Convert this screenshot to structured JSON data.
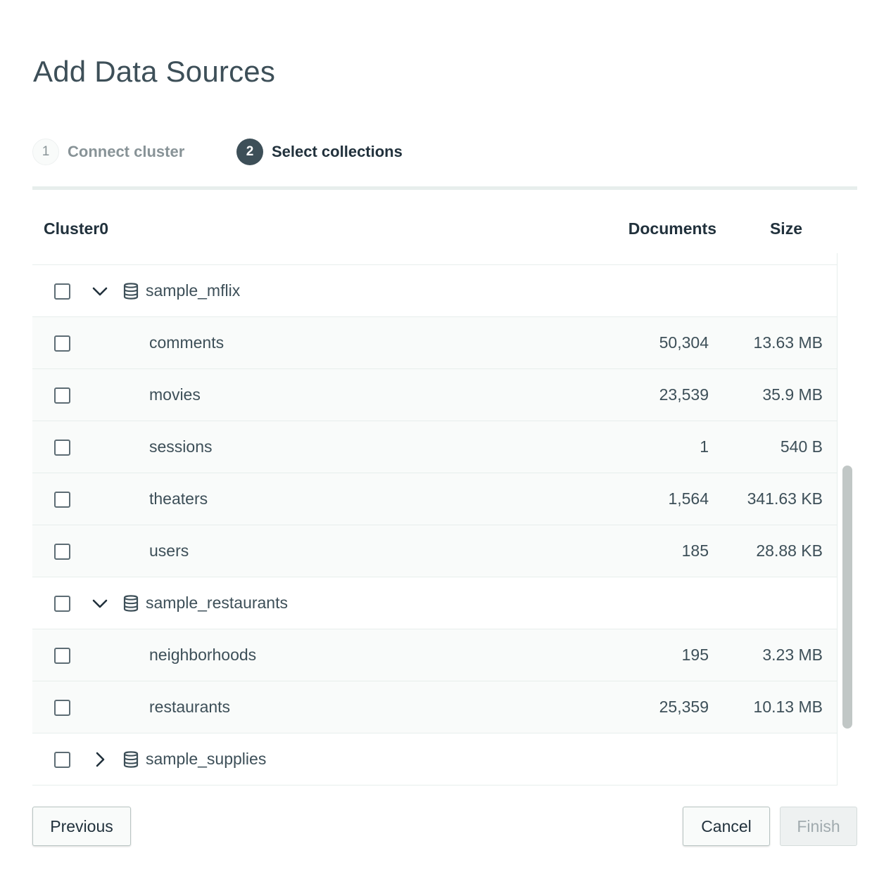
{
  "modal": {
    "title": "Add Data Sources"
  },
  "stepper": {
    "steps": [
      {
        "number": "1",
        "label": "Connect cluster"
      },
      {
        "number": "2",
        "label": "Select collections"
      }
    ]
  },
  "table": {
    "headers": {
      "name": "Cluster0",
      "documents": "Documents",
      "size": "Size"
    },
    "databases": [
      {
        "name": "sample_mflix",
        "collections": [
          {
            "name": "comments",
            "documents": "50,304",
            "size": "13.63 MB"
          },
          {
            "name": "movies",
            "documents": "23,539",
            "size": "35.9 MB"
          },
          {
            "name": "sessions",
            "documents": "1",
            "size": "540 B"
          },
          {
            "name": "theaters",
            "documents": "1,564",
            "size": "341.63 KB"
          },
          {
            "name": "users",
            "documents": "185",
            "size": "28.88 KB"
          }
        ]
      },
      {
        "name": "sample_restaurants",
        "collections": [
          {
            "name": "neighborhoods",
            "documents": "195",
            "size": "3.23 MB"
          },
          {
            "name": "restaurants",
            "documents": "25,359",
            "size": "10.13 MB"
          }
        ]
      },
      {
        "name": "sample_supplies",
        "collections": []
      }
    ]
  },
  "footer": {
    "previous_label": "Previous",
    "cancel_label": "Cancel",
    "finish_label": "Finish"
  }
}
